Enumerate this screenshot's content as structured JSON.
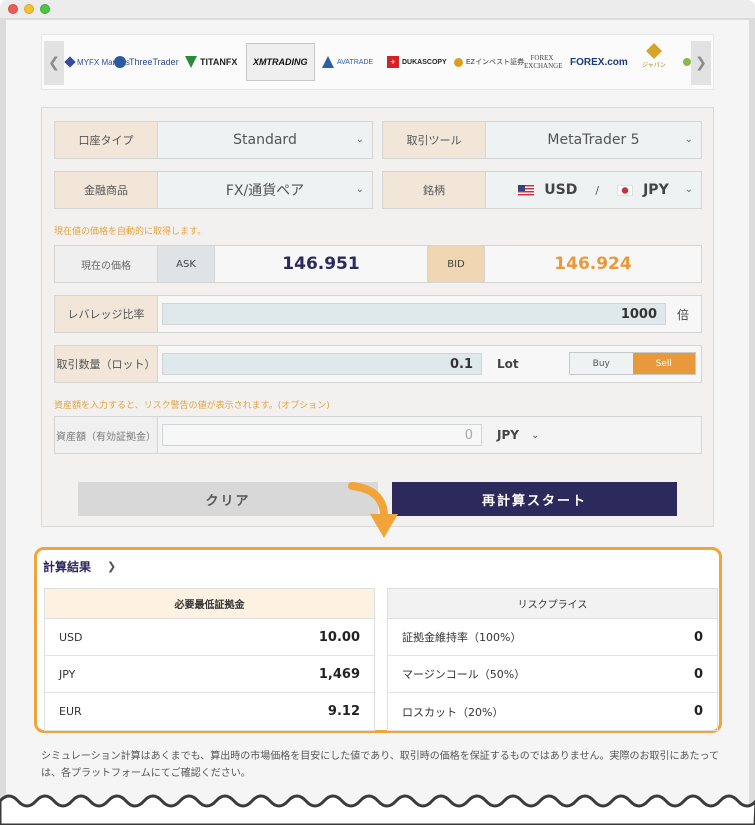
{
  "carousel": {
    "brokers": [
      "MYFX Markets",
      "ThreeTrader",
      "TITANFX",
      "XMTRADING",
      "AVATRADE",
      "DUKASCOPY",
      "EZインベスト証券",
      "FOREX EXCHANGE",
      "FOREX.com",
      "ジャパン"
    ],
    "active": "XMTRADING"
  },
  "form": {
    "account_type": {
      "label": "口座タイプ",
      "value": "Standard"
    },
    "tool": {
      "label": "取引ツール",
      "value": "MetaTrader 5"
    },
    "product": {
      "label": "金融商品",
      "value": "FX/通貨ペア"
    },
    "symbol": {
      "label": "銘柄",
      "base": "USD",
      "sep": "/",
      "quote": "JPY"
    },
    "price_note": "現在値の価格を自動的に取得します。",
    "price": {
      "label": "現在の価格",
      "ask_label": "ASK",
      "ask": "146.951",
      "bid_label": "BID",
      "bid": "146.924"
    },
    "leverage": {
      "label": "レバレッジ比率",
      "value": "1000",
      "unit": "倍"
    },
    "lot": {
      "label": "取引数量（ロット）",
      "value": "0.1",
      "unit": "Lot",
      "buy": "Buy",
      "sell": "Sell"
    },
    "asset_note": "資産額を入力すると、リスク警告の値が表示されます。(オプション)",
    "asset": {
      "label": "資産額（有効証拠金）",
      "value": "0",
      "currency": "JPY"
    }
  },
  "buttons": {
    "clear": "クリア",
    "start": "再計算スタート"
  },
  "results": {
    "title": "計算結果",
    "chevron": "❯",
    "margin_header": "必要最低証拠金",
    "margin_rows": [
      {
        "label": "USD",
        "value": "10.00"
      },
      {
        "label": "JPY",
        "value": "1,469"
      },
      {
        "label": "EUR",
        "value": "9.12"
      }
    ],
    "risk_header": "リスクプライス",
    "risk_rows": [
      {
        "label": "証拠金維持率（100%）",
        "value": "0"
      },
      {
        "label": "マージンコール（50%）",
        "value": "0"
      },
      {
        "label": "ロスカット（20%）",
        "value": "0"
      }
    ]
  },
  "disclaimer": "シミュレーション計算はあくまでも、算出時の市場価格を目安にした値であり、取引時の価格を保証するものではありません。実際のお取引にあたっては、各プラットフォームにてご確認ください。",
  "colors": {
    "accent": "#f0a43a",
    "navy": "#2c2a5c",
    "ask": "#2c2a5c",
    "bid": "#e8993c"
  }
}
